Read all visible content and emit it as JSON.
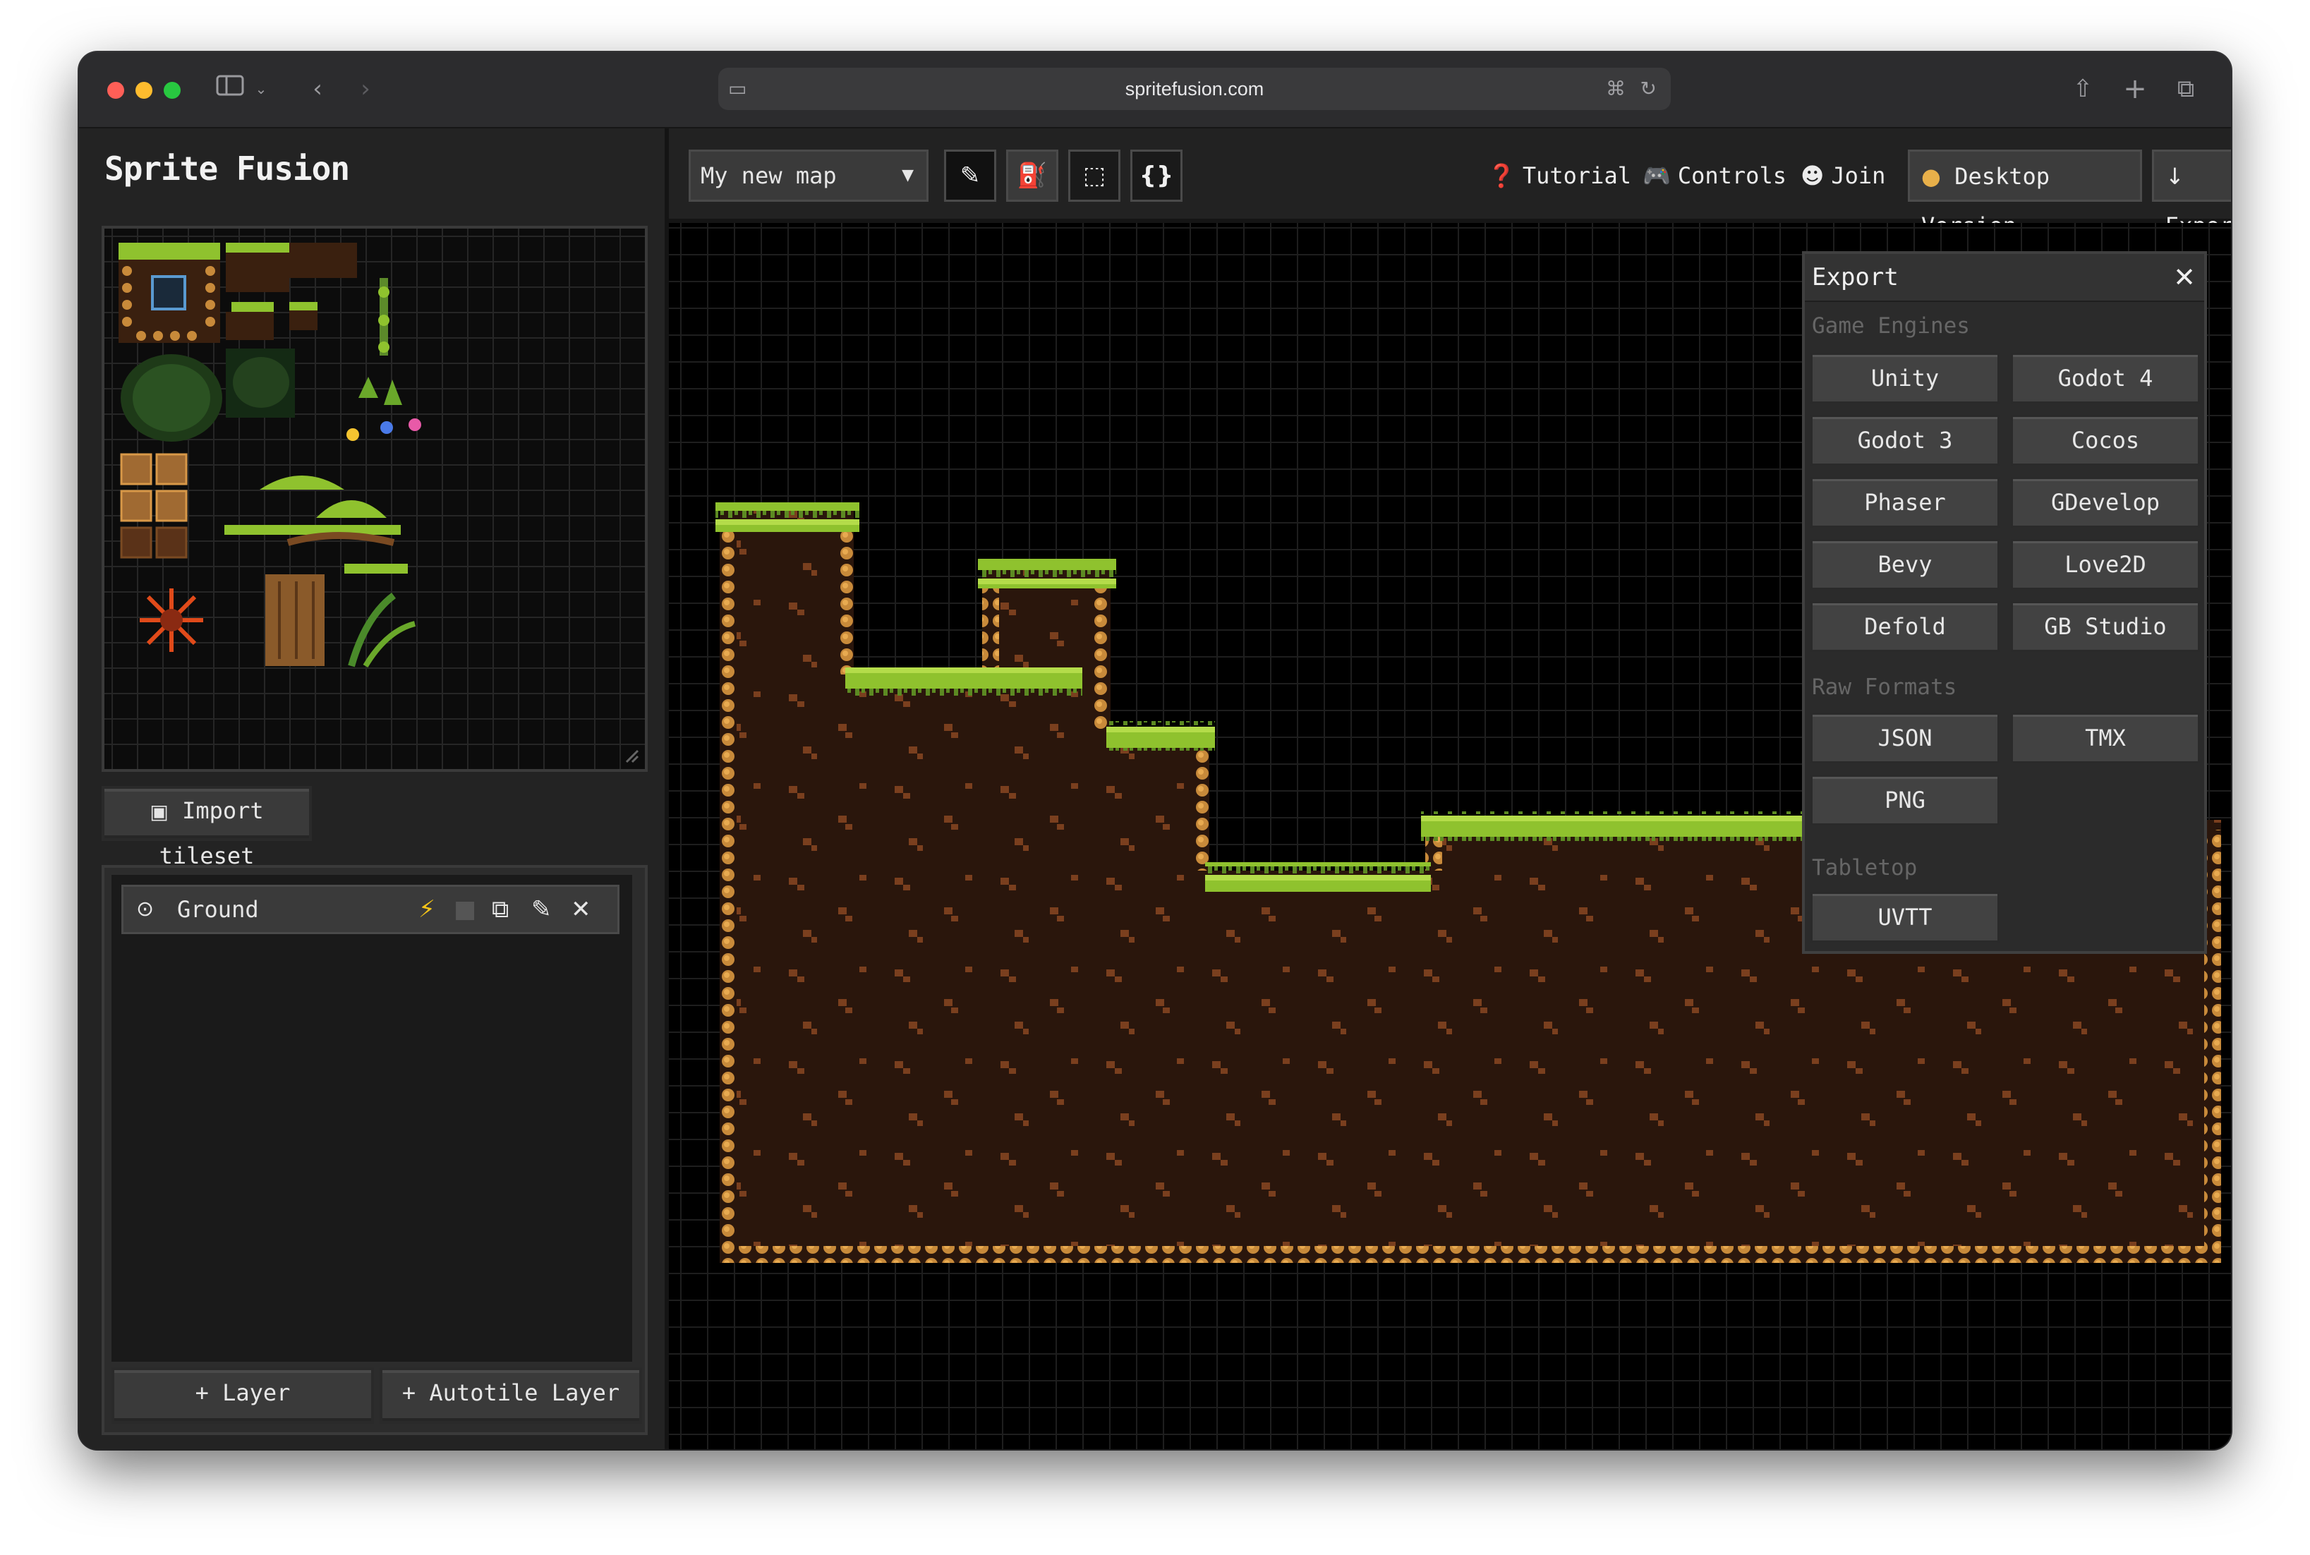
{
  "browser": {
    "url": "spritefusion.com",
    "back_icon": "‹",
    "forward_icon": "›"
  },
  "app": {
    "logo": "Sprite Fusion",
    "import_tileset_label": "Import tileset",
    "layers": [
      {
        "name": "Ground"
      }
    ],
    "add_layer_label": "+ Layer",
    "add_autotile_layer_label": "+ Autotile Layer"
  },
  "toolbar": {
    "map_name": "My new map",
    "tutorial_label": "Tutorial",
    "controls_label": "Controls",
    "join_label": "Join",
    "desktop_label": "Desktop Version",
    "export_label": "Export"
  },
  "export_panel": {
    "title": "Export",
    "sections": {
      "engines": "Game Engines",
      "raw": "Raw Formats",
      "tabletop": "Tabletop"
    },
    "engines": [
      "Unity",
      "Godot 4",
      "Godot 3",
      "Cocos",
      "Phaser",
      "GDevelop",
      "Bevy",
      "Love2D",
      "Defold",
      "GB Studio"
    ],
    "raw": [
      "JSON",
      "TMX",
      "PNG"
    ],
    "tabletop": [
      "UVTT"
    ]
  },
  "colors": {
    "grass": "#8fc22e",
    "dirt": "#2a160c",
    "rock": "#c88a3a",
    "accent_lightning": "#f5c518"
  }
}
